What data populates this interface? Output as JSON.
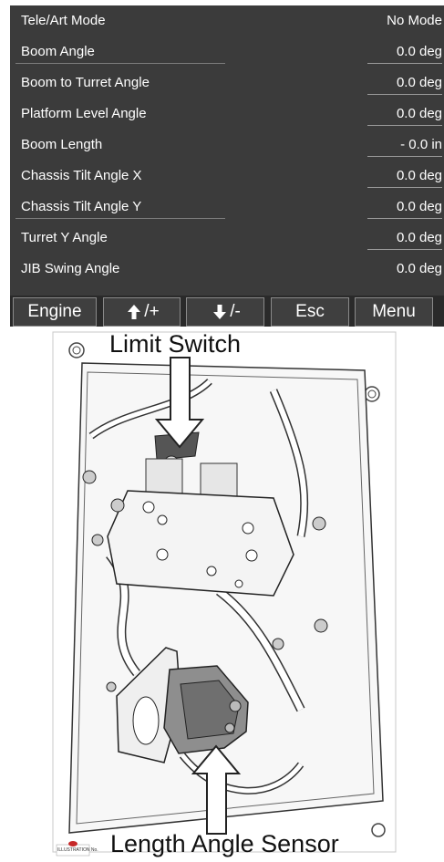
{
  "panel": {
    "rows": [
      {
        "label": "Tele/Art Mode",
        "value": "No Mode"
      },
      {
        "label": "Boom Angle",
        "value": "0.0 deg"
      },
      {
        "label": "Boom to Turret Angle",
        "value": "0.0 deg"
      },
      {
        "label": "Platform Level Angle",
        "value": "0.0 deg"
      },
      {
        "label": "Boom Length",
        "value": "- 0.0 in"
      },
      {
        "label": "Chassis Tilt Angle X",
        "value": "0.0 deg"
      },
      {
        "label": "Chassis Tilt Angle Y",
        "value": "0.0 deg"
      },
      {
        "label": "Turret Y Angle",
        "value": "0.0 deg"
      },
      {
        "label": "JIB Swing Angle",
        "value": "0.0 deg"
      }
    ],
    "softkeys": {
      "engine": "Engine",
      "up_plus": "+",
      "down_minus": "-",
      "esc": "Esc",
      "menu": "Menu"
    },
    "colors": {
      "background": "#3b3b3b",
      "text": "#ffffff",
      "key_border": "#8a8a8a"
    }
  },
  "illustration": {
    "top_label": "Limit Switch",
    "bottom_label": "Length Angle Sensor",
    "tag": "ILLUSTRATION No."
  }
}
